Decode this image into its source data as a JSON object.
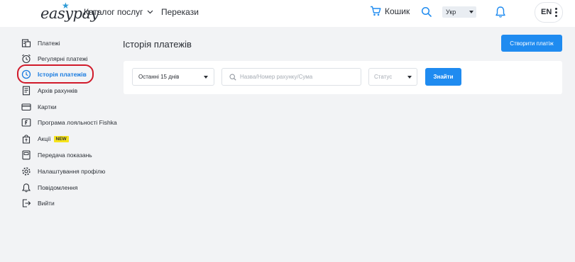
{
  "header": {
    "logo_text": "easypay",
    "catalog_label": "Каталог послуг",
    "transfers_label": "Перекази",
    "cart_label": "Кошик",
    "language_selected": "Укр",
    "english_label": "EN"
  },
  "sidebar": {
    "items": [
      {
        "label": "Платежі",
        "icon": "payments-icon"
      },
      {
        "label": "Регулярні платежі",
        "icon": "alarm-clock-icon"
      },
      {
        "label": "Історія платежів",
        "icon": "history-clock-icon",
        "active": true
      },
      {
        "label": "Архів рахунків",
        "icon": "archive-document-icon"
      },
      {
        "label": "Картки",
        "icon": "card-icon"
      },
      {
        "label": "Програма лояльності Fishka",
        "icon": "loyalty-f-icon"
      },
      {
        "label": "Акції",
        "icon": "promo-bag-icon",
        "badge": "NEW"
      },
      {
        "label": "Передача показань",
        "icon": "meter-icon"
      },
      {
        "label": "Налаштування профілю",
        "icon": "gear-icon"
      },
      {
        "label": "Повідомлення",
        "icon": "bell-icon"
      },
      {
        "label": "Вийти",
        "icon": "logout-icon"
      }
    ]
  },
  "main": {
    "title": "Історія платежів",
    "create_button": "Створити платіж",
    "filters": {
      "period_selected": "Останні 15 днів",
      "search_placeholder": "Назва/Номер рахунку/Сума",
      "status_placeholder": "Статус",
      "find_button": "Знайти"
    }
  },
  "colors": {
    "accent": "#1f8bf0",
    "active_text": "#1a7ce0",
    "highlight_ring": "#d11a2a",
    "badge_new": "#f6e31c",
    "page_bg": "#f2f3f5"
  }
}
